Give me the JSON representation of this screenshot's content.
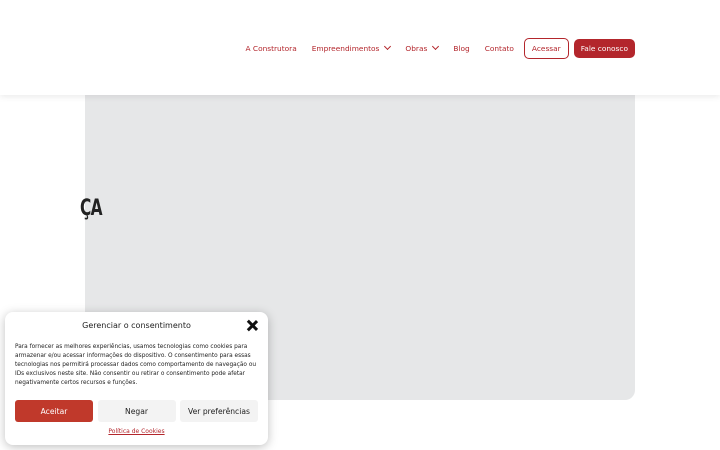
{
  "header": {
    "nav": [
      {
        "label": "A Construtora",
        "has_dropdown": false
      },
      {
        "label": "Empreendimentos",
        "has_dropdown": true
      },
      {
        "label": "Obras",
        "has_dropdown": true
      },
      {
        "label": "Blog",
        "has_dropdown": false
      },
      {
        "label": "Contato",
        "has_dropdown": false
      }
    ],
    "access_button": "Acessar",
    "contact_button": "Fale conosco"
  },
  "hero": {
    "partial_text": "ÇA"
  },
  "consent": {
    "title": "Gerenciar o consentimento",
    "body": "Para fornecer as melhores experiências, usamos tecnologias como cookies para armazenar e/ou acessar informações do dispositivo. O consentimento para essas tecnologias nos permitirá processar dados como comportamento de navegação ou IDs exclusivos neste site. Não consentir ou retirar o consentimento pode afetar negativamente certos recursos e funções.",
    "accept": "Aceitar",
    "deny": "Negar",
    "preferences": "Ver preferências",
    "policy_link": "Política de Cookies"
  },
  "colors": {
    "brand": "#b3262c",
    "accept": "#c0392b",
    "hero_bg": "#e6e7e8"
  }
}
